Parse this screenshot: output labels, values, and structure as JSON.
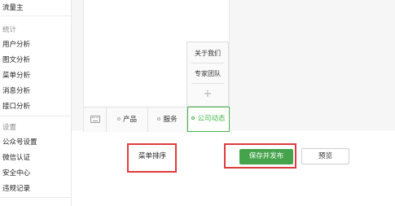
{
  "sidebar": {
    "top_item": "流量主",
    "sections": [
      {
        "title": "统计",
        "items": [
          "用户分析",
          "图文分析",
          "菜单分析",
          "消息分析",
          "接口分析"
        ]
      },
      {
        "title": "设置",
        "items": [
          "公众号设置",
          "微信认证",
          "安全中心",
          "违规记录"
        ]
      }
    ]
  },
  "preview": {
    "submenu_items": [
      "关于我们",
      "专家团队"
    ],
    "submenu_add": "+",
    "menu_tabs": [
      "产品",
      "服务",
      "公司动态"
    ],
    "active_tab": "公司动态"
  },
  "actions": {
    "sort_label": "菜单排序",
    "save_label": "保存并发布",
    "preview_label": "预览"
  },
  "colors": {
    "accent": "#44b549",
    "save_bg": "#44a34b",
    "highlight": "#e03a3e"
  }
}
